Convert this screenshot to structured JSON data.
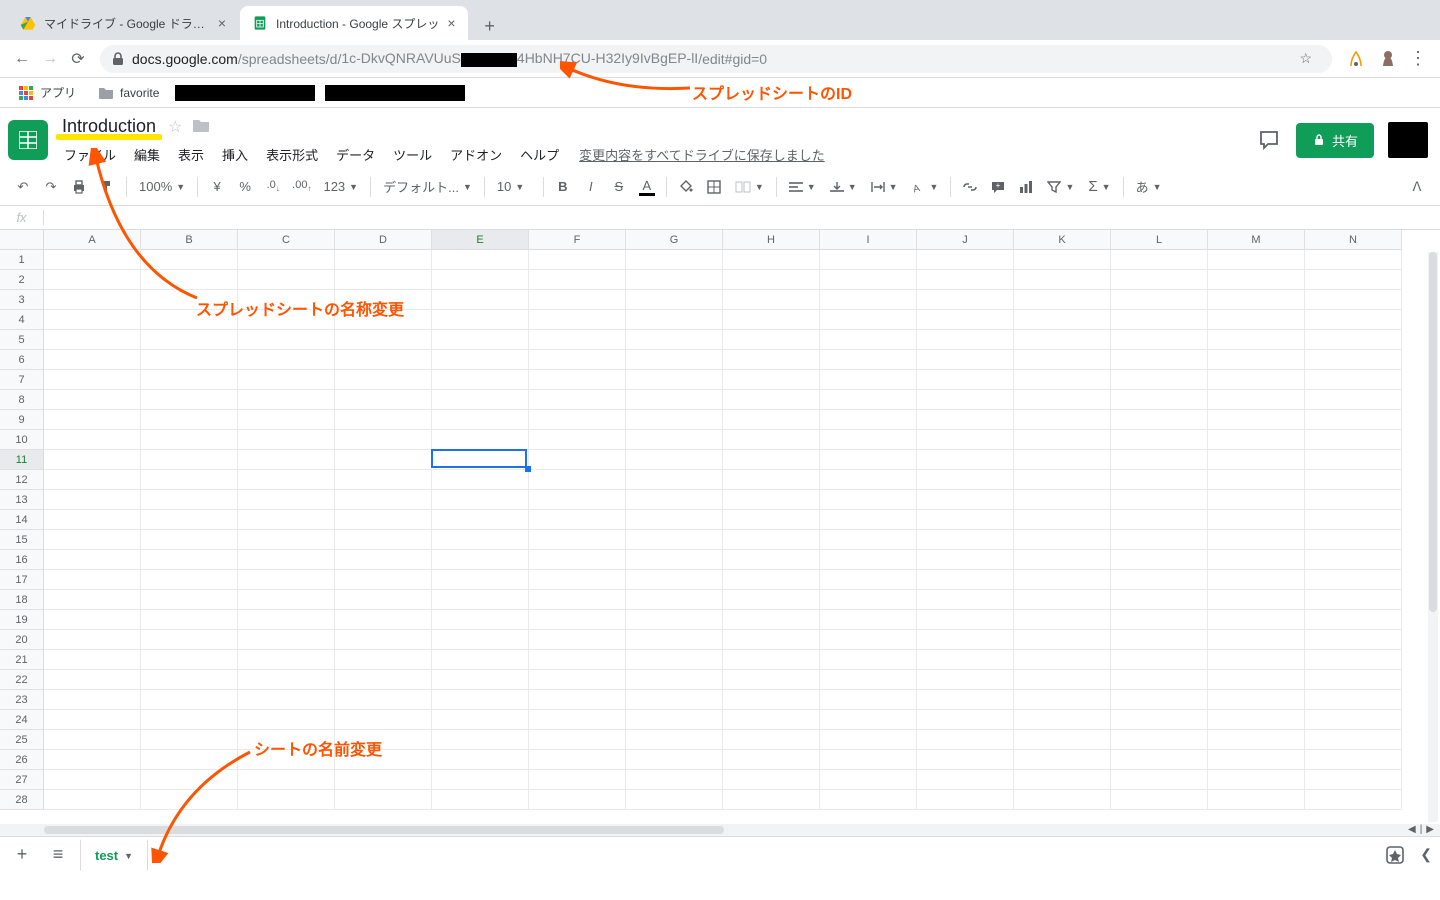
{
  "browser": {
    "tabs": [
      {
        "title": "マイドライブ - Google ドライブ",
        "active": false
      },
      {
        "title": "Introduction - Google スプレッ",
        "active": true
      }
    ],
    "url_host": "docs.google.com",
    "url_path_pre": "/spreadsheets/d/",
    "url_id_part1": "1c-DkvQNRAVUuS",
    "url_id_part2": "4HbNH7CU-H32Iy9IvBgEP-lI",
    "url_path_post": "/edit#gid=0",
    "bookmarks": {
      "apps": "アプリ",
      "favorite": "favorite"
    }
  },
  "doc": {
    "title": "Introduction",
    "menus": [
      "ファイル",
      "編集",
      "表示",
      "挿入",
      "表示形式",
      "データ",
      "ツール",
      "アドオン",
      "ヘルプ"
    ],
    "save_status": "変更内容をすべてドライブに保存しました",
    "share_label": "共有"
  },
  "toolbar": {
    "zoom": "100%",
    "currency": "¥",
    "percent": "%",
    "dec_dec": ".0",
    "inc_dec": ".00",
    "num_format": "123",
    "font": "デフォルト...",
    "font_size": "10",
    "ime": "あ"
  },
  "grid": {
    "columns": [
      "A",
      "B",
      "C",
      "D",
      "E",
      "F",
      "G",
      "H",
      "I",
      "J",
      "K",
      "L",
      "M",
      "N"
    ],
    "row_count": 28,
    "active_cell": "E11",
    "active_col_index": 4,
    "active_row_index": 10
  },
  "sheet_bar": {
    "active_tab": "test"
  },
  "annotations": {
    "url_id": "スプレッドシートのID",
    "title_change": "スプレッドシートの名称変更",
    "sheet_rename": "シートの名前変更"
  }
}
